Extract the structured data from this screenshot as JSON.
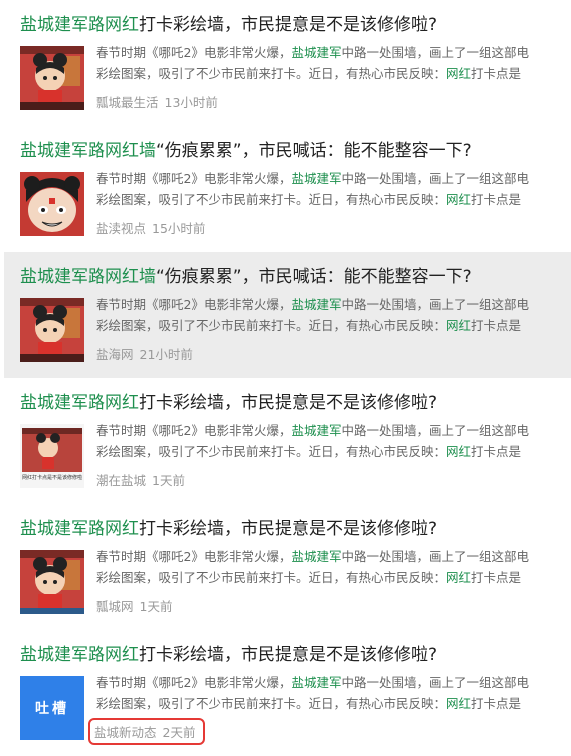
{
  "results": [
    {
      "title_kw": "盐城建军路网红",
      "title_rest": "打卡彩绘墙，市民提意是不是该修修啦?",
      "snippet_l1_a": "春节时期《哪吒2》电影非常火爆，",
      "snippet_l1_kw": "盐城建军",
      "snippet_l1_b": "中路一处围墙，画上了一组这部电",
      "snippet_l2_a": "彩绘图案，吸引了不少市民前来打卡。近日，有热心市民反映：",
      "snippet_l2_kw": "网红",
      "snippet_l2_b": "打卡点是",
      "source": "瓢城最生活",
      "time": "13小时前",
      "thumb_icon": "nezha-wall-thumbnail"
    },
    {
      "title_kw": "盐城建军路网红墙",
      "title_rest": "“伤痕累累”，市民喊话：能不能整容一下?",
      "snippet_l1_a": "春节时期《哪吒2》电影非常火爆，",
      "snippet_l1_kw": "盐城建军",
      "snippet_l1_b": "中路一处围墙，画上了一组这部电",
      "snippet_l2_a": "彩绘图案，吸引了不少市民前来打卡。近日，有热心市民反映：",
      "snippet_l2_kw": "网红",
      "snippet_l2_b": "打卡点是",
      "source": "盐渎视点",
      "time": "15小时前",
      "thumb_icon": "nezha-face-thumbnail"
    },
    {
      "title_kw": "盐城建军路网红墙",
      "title_rest": "“伤痕累累”，市民喊话：能不能整容一下?",
      "snippet_l1_a": "春节时期《哪吒2》电影非常火爆，",
      "snippet_l1_kw": "盐城建军",
      "snippet_l1_b": "中路一处围墙，画上了一组这部电",
      "snippet_l2_a": "彩绘图案，吸引了不少市民前来打卡。近日，有热心市民反映：",
      "snippet_l2_kw": "网红",
      "snippet_l2_b": "打卡点是",
      "source": "盐海网",
      "time": "21小时前",
      "thumb_icon": "nezha-wall-thumbnail"
    },
    {
      "title_kw": "盐城建军路网红",
      "title_rest": "打卡彩绘墙，市民提意是不是该修修啦?",
      "snippet_l1_a": "春节时期《哪吒2》电影非常火爆，",
      "snippet_l1_kw": "盐城建军",
      "snippet_l1_b": "中路一处围墙，画上了一组这部电",
      "snippet_l2_a": "彩绘图案，吸引了不少市民前来打卡。近日，有热心市民反映：",
      "snippet_l2_kw": "网红",
      "snippet_l2_b": "打卡点是",
      "source": "潮在盐城",
      "time": "1天前",
      "thumb_icon": "nezha-wall-screenshot-thumbnail",
      "thumb_caption": "网红打卡点是不是该修修啦"
    },
    {
      "title_kw": "盐城建军路网红",
      "title_rest": "打卡彩绘墙，市民提意是不是该修修啦?",
      "snippet_l1_a": "春节时期《哪吒2》电影非常火爆，",
      "snippet_l1_kw": "盐城建军",
      "snippet_l1_b": "中路一处围墙，画上了一组这部电",
      "snippet_l2_a": "彩绘图案，吸引了不少市民前来打卡。近日，有热心市民反映：",
      "snippet_l2_kw": "网红",
      "snippet_l2_b": "打卡点是",
      "source": "瓢城网",
      "time": "1天前",
      "thumb_icon": "nezha-wall-thumbnail"
    },
    {
      "title_kw": "盐城建军路网红",
      "title_rest": "打卡彩绘墙，市民提意是不是该修修啦?",
      "snippet_l1_a": "春节时期《哪吒2》电影非常火爆，",
      "snippet_l1_kw": "盐城建军",
      "snippet_l1_b": "中路一处围墙，画上了一组这部电",
      "snippet_l2_a": "彩绘图案，吸引了不少市民前来打卡。近日，有热心市民反映：",
      "snippet_l2_kw": "网红",
      "snippet_l2_b": "打卡点是",
      "source": "盐城新动态",
      "time": "2天前",
      "thumb_icon": "tucao-app-icon",
      "thumb_label": "吐槽"
    }
  ],
  "colors": {
    "keyword": "#1e8f4e",
    "highlight_row": "#ececec",
    "annotation_box": "#e53935",
    "tucao_blue": "#2f80e8"
  }
}
